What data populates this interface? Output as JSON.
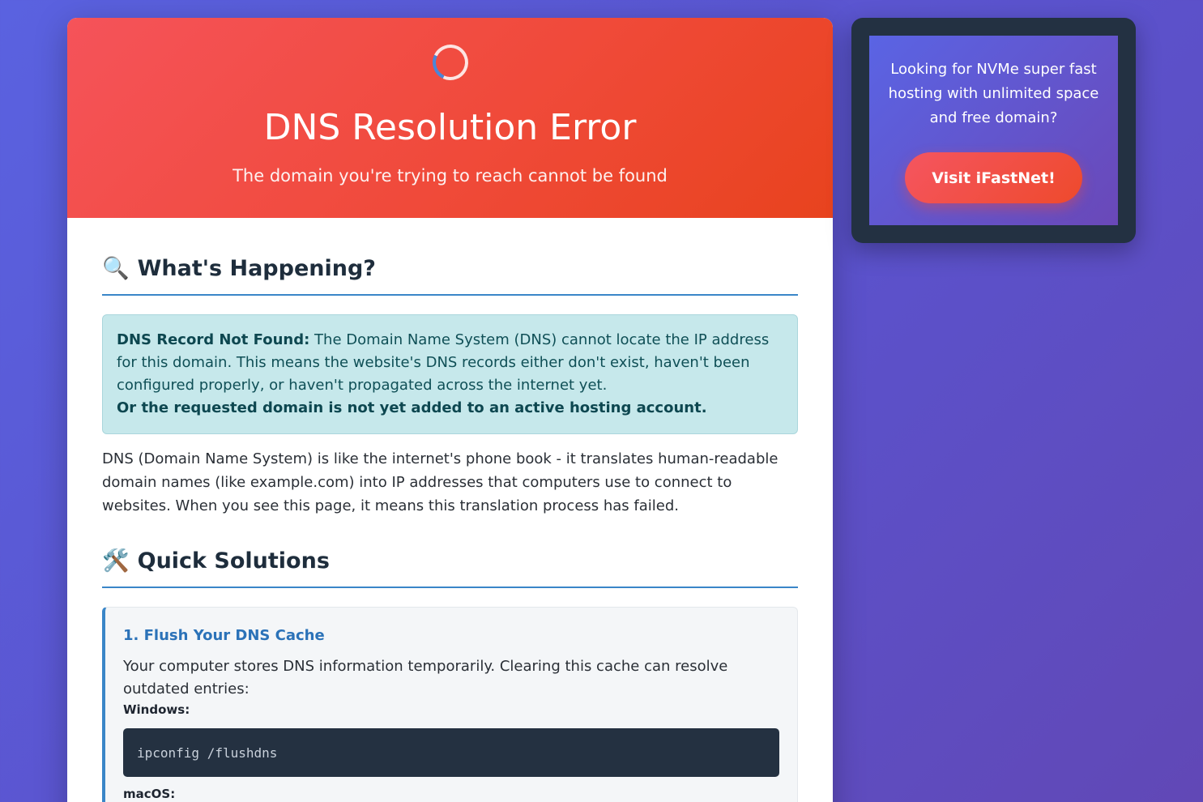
{
  "hero": {
    "title": "DNS Resolution Error",
    "subtitle": "The domain you're trying to reach cannot be found"
  },
  "sections": {
    "happening": {
      "icon": "🔍",
      "heading": "What's Happening?"
    },
    "solutions": {
      "icon": "🛠️",
      "heading": "Quick Solutions"
    }
  },
  "alert": {
    "strong_label": "DNS Record Not Found:",
    "text": " The Domain Name System (DNS) cannot locate the IP address for this domain. This means the website's DNS records either don't exist, haven't been configured properly, or haven't propagated across the internet yet.",
    "bold_line": "Or the requested domain is not yet added to an active hosting account."
  },
  "explanation": "DNS (Domain Name System) is like the internet's phone book - it translates human-readable domain names (like example.com) into IP addresses that computers use to connect to websites. When you see this page, it means this translation process has failed.",
  "solution_1": {
    "title": "1. Flush Your DNS Cache",
    "text": "Your computer stores DNS information temporarily. Clearing this cache can resolve outdated entries:",
    "windows_label": "Windows:",
    "windows_command": "ipconfig /flushdns",
    "macos_label": "macOS:"
  },
  "ad": {
    "text": "Looking for NVMe super fast hosting with unlimited space and free domain?",
    "button_label": "Visit iFastNet!"
  },
  "colors": {
    "hero_start": "#f5535a",
    "hero_end": "#e8431e",
    "accent_blue": "#3a86c8",
    "alert_bg": "#c6e8eb",
    "code_bg": "#243141",
    "ad_frame": "#233142"
  }
}
